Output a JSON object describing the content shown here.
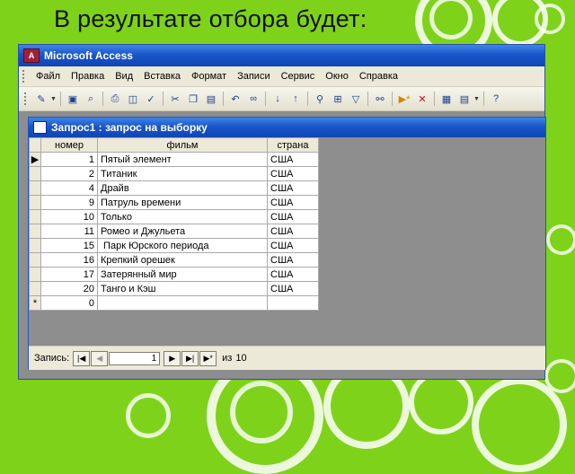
{
  "slide": {
    "title": "В результате отбора будет:"
  },
  "app": {
    "title": "Microsoft Access",
    "icon": "access-icon",
    "icon_letter": "A"
  },
  "menu": [
    "Файл",
    "Правка",
    "Вид",
    "Вставка",
    "Формат",
    "Записи",
    "Сервис",
    "Окно",
    "Справка"
  ],
  "query_window": {
    "title": "Запрос1 : запрос на выборку"
  },
  "columns": [
    "номер",
    "фильм",
    "страна"
  ],
  "rows": [
    {
      "num": "1",
      "film": "Пятый элемент",
      "country": "США"
    },
    {
      "num": "2",
      "film": "Титаник",
      "country": "США"
    },
    {
      "num": "4",
      "film": "Драйв",
      "country": "США"
    },
    {
      "num": "9",
      "film": "Патруль времени",
      "country": "США"
    },
    {
      "num": "10",
      "film": "Только",
      "country": "США"
    },
    {
      "num": "11",
      "film": "Ромео и Джульета",
      "country": "США"
    },
    {
      "num": "15",
      "film": " Парк Юрского периода",
      "country": "США"
    },
    {
      "num": "16",
      "film": "Крепкий орешек",
      "country": "США"
    },
    {
      "num": "17",
      "film": "Затерянный мир",
      "country": "США"
    },
    {
      "num": "20",
      "film": "Танго и Кэш",
      "country": "США"
    }
  ],
  "new_row": {
    "marker": "*",
    "num": "0"
  },
  "current_row_marker": "▶",
  "navigation": {
    "record_label": "Запись:",
    "current": "1",
    "of_label": "из",
    "total": "10",
    "first": "|◀",
    "prev": "◀",
    "next": "▶",
    "last": "▶|",
    "new": "▶*"
  },
  "toolbar_icons": [
    "design-view-icon",
    "save-icon",
    "search-db-icon",
    "print-icon",
    "print-preview-icon",
    "spelling-icon",
    "cut-icon",
    "copy-icon",
    "paste-icon",
    "undo-icon",
    "hyperlink-icon",
    "sort-ascending-icon",
    "sort-descending-icon",
    "filter-by-selection-icon",
    "filter-by-form-icon",
    "apply-filter-icon",
    "find-icon",
    "new-record-icon",
    "delete-record-icon",
    "database-window-icon",
    "new-object-icon",
    "help-icon"
  ],
  "colors": {
    "slide_bg": "#7fd21a",
    "titlebar": "#1a56c8",
    "window_bg": "#ece9d8",
    "mdi_bg": "#8d8d8d"
  }
}
